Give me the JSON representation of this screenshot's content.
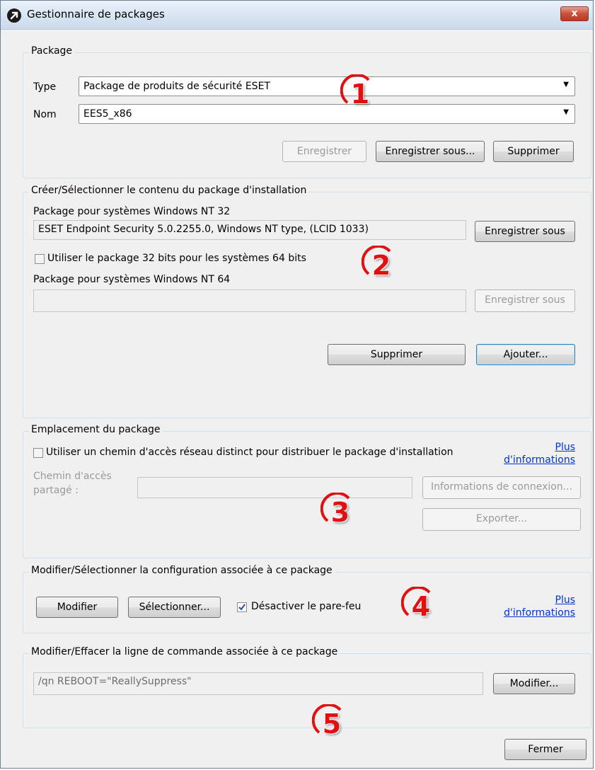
{
  "window": {
    "title": "Gestionnaire de packages",
    "close_label": "x"
  },
  "package": {
    "legend": "Package",
    "type_label": "Type",
    "type_value": "Package de produits de sécurité ESET",
    "name_label": "Nom",
    "name_value": "EES5_x86",
    "save_label": "Enregistrer",
    "save_as_label": "Enregistrer sous...",
    "delete_label": "Supprimer"
  },
  "content": {
    "legend": "Créer/Sélectionner le contenu du package d'installation",
    "nt32_label": "Package pour systèmes Windows NT 32",
    "nt32_value": "ESET Endpoint Security 5.0.2255.0, Windows NT type, (LCID 1033)",
    "nt32_save_label": "Enregistrer sous",
    "use32_label": "Utiliser le package 32 bits pour les systèmes 64 bits",
    "use32_checked": false,
    "nt64_label": "Package pour systèmes Windows NT 64",
    "nt64_value": "",
    "nt64_save_label": "Enregistrer sous",
    "delete_label": "Supprimer",
    "add_label": "Ajouter..."
  },
  "location": {
    "legend": "Emplacement du package",
    "use_network_label": "Utiliser un chemin d'accès réseau distinct pour distribuer le package d'installation",
    "use_network_checked": false,
    "more_info_line1": "Plus",
    "more_info_line2": "d'informations",
    "share_path_line1": "Chemin d'accès",
    "share_path_line2": "partagé :",
    "share_path_value": "",
    "connection_info_label": "Informations de connexion...",
    "export_label": "Exporter..."
  },
  "config": {
    "legend": "Modifier/Sélectionner la configuration associée à ce package",
    "modify_label": "Modifier",
    "select_label": "Sélectionner...",
    "disable_firewall_label": "Désactiver le pare-feu",
    "disable_firewall_checked": true,
    "more_info_line1": "Plus",
    "more_info_line2": "d'informations"
  },
  "cmdline": {
    "legend": "Modifier/Effacer la ligne de commande associée à ce package",
    "value": "/qn REBOOT=\"ReallySuppress\"",
    "modify_label": "Modifier..."
  },
  "footer": {
    "close_label": "Fermer"
  },
  "annotations": [
    "1",
    "2",
    "3",
    "4",
    "5"
  ],
  "colors": {
    "annotation": "#e01111",
    "link": "#0033cc",
    "dialog_bg": "#f0f0f0"
  }
}
